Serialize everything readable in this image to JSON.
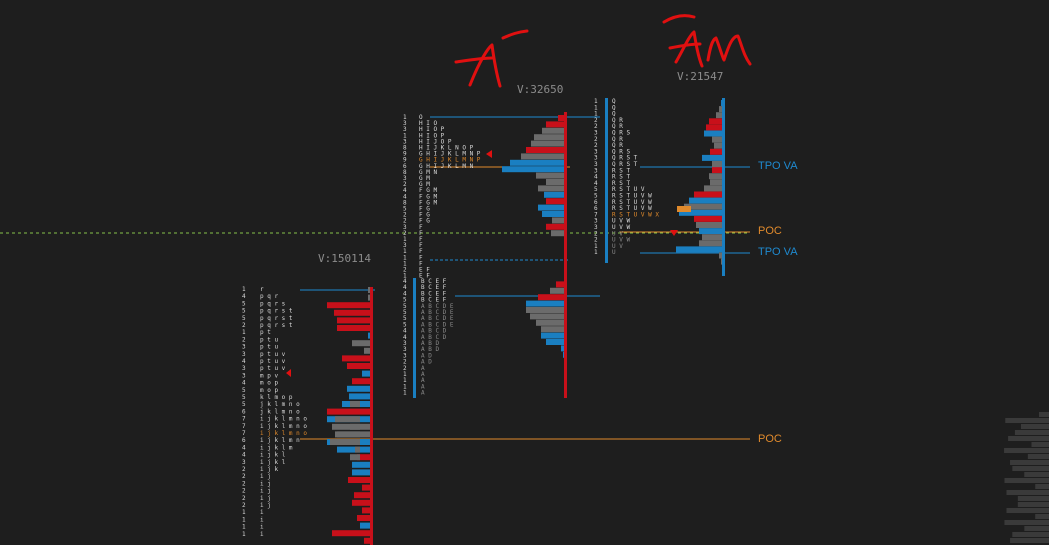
{
  "colors": {
    "background": "#1e1e1e",
    "buy": "#1a7fc1",
    "sell": "#c8101a",
    "neutral": "#6b6b6b",
    "poc": "#e08a2c",
    "tpo_va": "#1f8ad0",
    "annotation": "#e01010",
    "dashed_line": "#86c34a",
    "letters": "#d9d9d9",
    "letters_dim": "#8a8a8a"
  },
  "labels": {
    "vol_left": "V:150114",
    "vol_mid": "V:32650",
    "vol_right": "V:21547",
    "poc_upper": "POC",
    "poc_lower": "POC",
    "tpo_va_upper": "TPO VA",
    "tpo_va_lower": "TPO VA"
  },
  "handwritten": {
    "mid": "A⁻",
    "right": "AM"
  },
  "profile_left": {
    "counts": [
      "1",
      "4",
      "5",
      "5",
      "5",
      "2",
      "1",
      "2",
      "3",
      "3",
      "4",
      "3",
      "3",
      "4",
      "5",
      "5",
      "5",
      "6",
      "7",
      "7",
      "7",
      "6",
      "4",
      "4",
      "3",
      "2",
      "2",
      "2",
      "2",
      "2",
      "2",
      "1",
      "1",
      "1",
      "1"
    ],
    "letters": [
      "r",
      "pqr",
      "pqrs",
      "pqrst",
      "pqrst",
      "pqrst",
      "pt",
      "ptu",
      "ptu",
      "ptuv",
      "ptuv",
      "ptuv",
      "mpv",
      "mop",
      "mop",
      "klmop",
      "jklmno",
      "jklmno",
      "ijklmno",
      "ijklmno",
      "ijklmno",
      "ijklmn",
      "ijklm",
      "ijkl",
      "ijkl",
      "ijk",
      "ij",
      "ij",
      "ij",
      "ij",
      "ij",
      "i",
      "i",
      "i",
      "i"
    ],
    "bars": [
      [
        0,
        0,
        0
      ],
      [
        0,
        0,
        0
      ],
      [
        45,
        0,
        0
      ],
      [
        38,
        0,
        0
      ],
      [
        35,
        0,
        0
      ],
      [
        35,
        0,
        0
      ],
      [
        3,
        0,
        0
      ],
      [
        20,
        0,
        0
      ],
      [
        8,
        0,
        0
      ],
      [
        30,
        0,
        0
      ],
      [
        25,
        0,
        0
      ],
      [
        10,
        0,
        0
      ],
      [
        20,
        0,
        0
      ],
      [
        25,
        0,
        0
      ],
      [
        23,
        0,
        0
      ],
      [
        0,
        10,
        30
      ],
      [
        45,
        0,
        0
      ],
      [
        0,
        25,
        45
      ],
      [
        0,
        10,
        40
      ],
      [
        0,
        25,
        35
      ],
      [
        0,
        30,
        45
      ],
      [
        0,
        5,
        35
      ],
      [
        15,
        10,
        20
      ],
      [
        20,
        0,
        25
      ],
      [
        0,
        0,
        20
      ],
      [
        24,
        0,
        0
      ],
      [
        10,
        0,
        0
      ],
      [
        18,
        0,
        0
      ],
      [
        20,
        0,
        0
      ],
      [
        10,
        0,
        0
      ],
      [
        15,
        0,
        0
      ],
      [
        12,
        0,
        0
      ],
      [
        40,
        0,
        0
      ],
      [
        8,
        0,
        0
      ],
      [
        0,
        0,
        0
      ]
    ],
    "bar_kind": [
      "n",
      "n",
      "s",
      "s",
      "s",
      "s",
      "b",
      "n",
      "n",
      "s",
      "s",
      "b",
      "s",
      "b",
      "b",
      "b",
      "s",
      "b",
      "n",
      "n",
      "b",
      "b",
      "s",
      "b",
      "b",
      "s",
      "s",
      "s",
      "s",
      "s",
      "s",
      "b",
      "s",
      "s",
      "n"
    ]
  },
  "profile_mid": {
    "counts": [
      "1",
      "3",
      "3",
      "1",
      "3",
      "8",
      "9",
      "9",
      "6",
      "8",
      "3",
      "2",
      "4",
      "4",
      "8",
      "5",
      "2",
      "2",
      "3",
      "2",
      "1",
      "3",
      "1",
      "1",
      "1",
      "2",
      "1"
    ],
    "letters": [
      "O",
      "HIO",
      "HIOP",
      "HIOP",
      "HIJOP",
      "HIJKLNOP",
      "GHIJKLMNP",
      "GHIJKLMNP",
      "GHIJKLMN",
      "GMN",
      "GM",
      "GM",
      "FGM",
      "FGM",
      "FGM",
      "FG",
      "FG",
      "FG",
      "F",
      "F",
      "F",
      "F",
      "F",
      "F",
      "F",
      "EF",
      "EF"
    ],
    "counts2": [
      "4",
      "4",
      "4",
      "5",
      "5",
      "5",
      "5",
      "5",
      "4",
      "4",
      "3",
      "3",
      "3",
      "2",
      "2",
      "1",
      "1",
      "1",
      "1"
    ],
    "letters2": [
      "BCEF",
      "BCEF",
      "BCEF",
      "BCEF",
      "ABCDE",
      "ABCDE",
      "ABCDE",
      "ABCDE",
      "ABCD",
      "ABCD",
      "ABD",
      "ABD",
      "AD",
      "AD",
      "A",
      "A",
      "A",
      "A",
      "A"
    ]
  },
  "profile_right": {
    "counts": [
      "1",
      "1",
      "1",
      "2",
      "2",
      "3",
      "2",
      "2",
      "3",
      "3",
      "3",
      "3",
      "4",
      "4",
      "5",
      "5",
      "6",
      "6",
      "7",
      "3",
      "3",
      "2",
      "2",
      "1",
      "1"
    ],
    "letters": [
      "Q",
      "Q",
      "Q",
      "QR",
      "QR",
      "QRS",
      "QR",
      "QR",
      "QRS",
      "QRST",
      "QRST",
      "RST",
      "RST",
      "RST",
      "RSTUV",
      "RSTUVW",
      "RSTUVW",
      "RSTUVW",
      "RSTUVWX",
      "UVW",
      "UVW",
      "UV",
      "UVW",
      "UV",
      "U"
    ]
  }
}
